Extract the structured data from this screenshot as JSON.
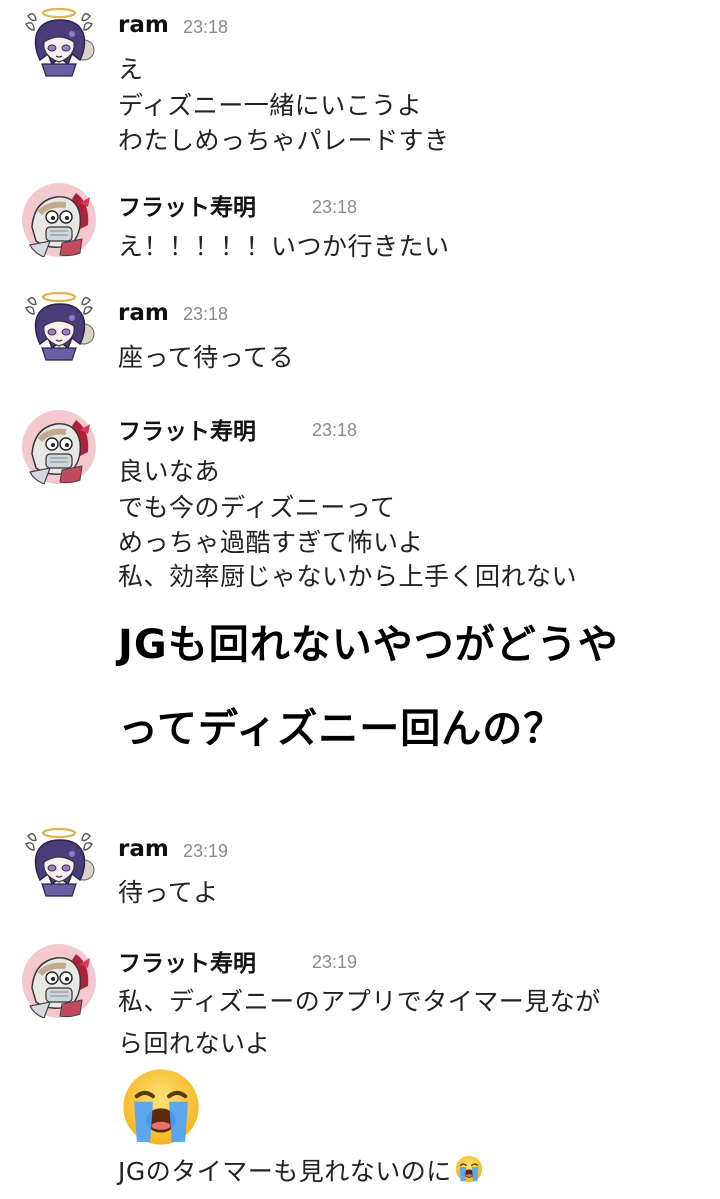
{
  "users": {
    "ram": "ram",
    "flat": "フラット寿明"
  },
  "messages": [
    {
      "user": "ram",
      "time": "23:18",
      "lines": [
        "え",
        "ディズニー一緒にいこうよ",
        "わたしめっちゃパレードすき"
      ]
    },
    {
      "user": "フラット寿明",
      "time": "23:18",
      "lines": [
        "え！！！！！いつか行きたい"
      ]
    },
    {
      "user": "ram",
      "time": "23:18",
      "lines": [
        "座って待ってる"
      ]
    },
    {
      "user": "フラット寿明",
      "time": "23:18",
      "lines": [
        "良いなあ",
        "でも今のディズニーって",
        "めっちゃ過酷すぎて怖いよ",
        "私、効率厨じゃないから上手く回れない"
      ],
      "big_lines": [
        "JGも回れないやつがどうや",
        "ってディズニー回んの？"
      ]
    },
    {
      "user": "ram",
      "time": "23:19",
      "lines": [
        "待ってよ"
      ]
    },
    {
      "user": "フラット寿明",
      "time": "23:19",
      "lines": [
        "私、ディズニーのアプリでタイマー見なが",
        "ら回れないよ"
      ],
      "emoji": "loudly-crying-face",
      "last_line": "JGのタイマーも見れないのに"
    }
  ],
  "colors": {
    "background": "#ffffff",
    "text": "#222222",
    "timestamp": "#8a8a8a",
    "flat_avatar_bg": "#f3c9cf"
  }
}
